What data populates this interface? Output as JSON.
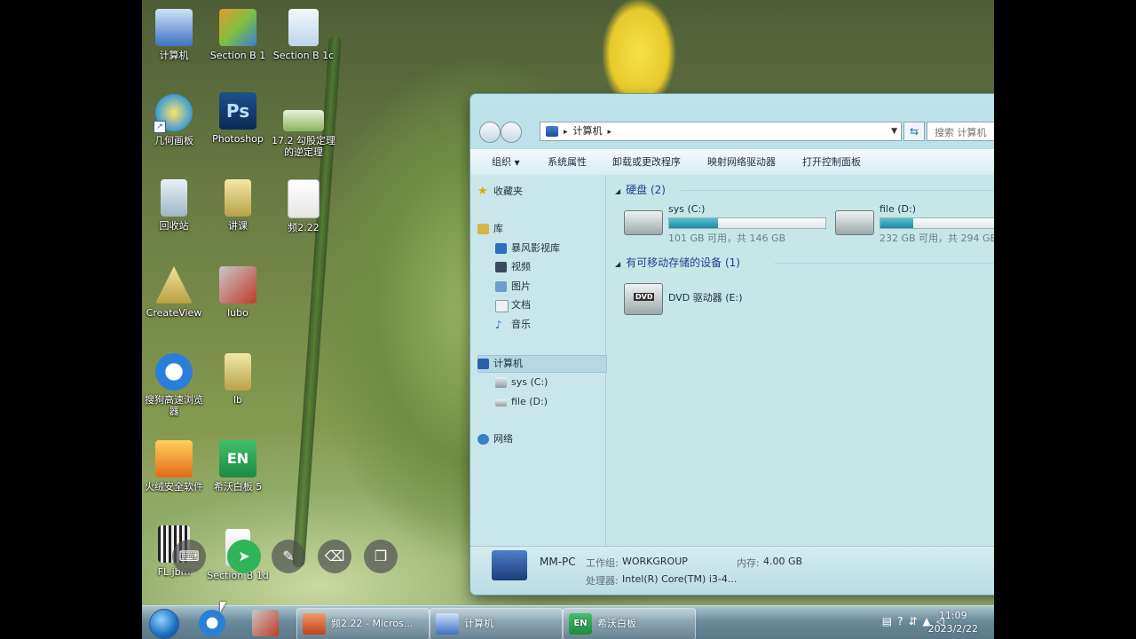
{
  "desktop": {
    "icons": [
      {
        "label": "计算机",
        "icon": "computer-icon"
      },
      {
        "label": "Section B 1",
        "icon": "ppt-icon"
      },
      {
        "label": "Section B 1c",
        "icon": "mp3-icon"
      },
      {
        "label": "几何画板",
        "icon": "geometry-app-icon"
      },
      {
        "label": "Photoshop",
        "icon": "photoshop-icon"
      },
      {
        "label": "17.2 勾股定理的逆定理",
        "icon": "ppt-icon"
      },
      {
        "label": "回收站",
        "icon": "recycle-bin-icon"
      },
      {
        "label": "讲课",
        "icon": "folder-icon"
      },
      {
        "label": "频2.22",
        "icon": "ppt-icon"
      },
      {
        "label": "CreateView",
        "icon": "createview-icon"
      },
      {
        "label": "lubo",
        "icon": "tools-icon"
      },
      {
        "label": "搜狗高速浏览器",
        "icon": "sogou-browser-icon"
      },
      {
        "label": "lb",
        "icon": "folder-icon"
      },
      {
        "label": "火绒安全软件",
        "icon": "huorong-icon"
      },
      {
        "label": "希沃白板 5",
        "icon": "seewo-icon"
      },
      {
        "label": "FL.jbm",
        "icon": "qr-file-icon"
      },
      {
        "label": "Section B 1d",
        "icon": "file-icon"
      }
    ]
  },
  "explorer": {
    "address": "计算机",
    "search_placeholder": "搜索 计算机",
    "toolbar": {
      "organize": "组织",
      "system_properties": "系统属性",
      "uninstall": "卸载或更改程序",
      "map_drive": "映射网络驱动器",
      "control_panel": "打开控制面板"
    },
    "nav": {
      "favorites": "收藏夹",
      "library": "库",
      "library_items": [
        "暴风影视库",
        "视频",
        "图片",
        "文档",
        "音乐"
      ],
      "computer": "计算机",
      "drives": [
        "sys (C:)",
        "file (D:)"
      ],
      "network": "网络"
    },
    "groups": {
      "hdd": "硬盘 (2)",
      "removable": "有可移动存储的设备 (1)"
    },
    "drives": [
      {
        "name": "sys (C:)",
        "size_text": "101 GB 可用，共 146 GB",
        "used_fraction": 0.31
      },
      {
        "name": "file (D:)",
        "size_text": "232 GB 可用，共 294 GB",
        "used_fraction": 0.21
      }
    ],
    "dvd": {
      "name": "DVD 驱动器 (E:)",
      "badge": "DVD"
    },
    "status": {
      "pc_name": "MM-PC",
      "workgroup_label": "工作组:",
      "workgroup": "WORKGROUP",
      "memory_label": "内存:",
      "memory": "4.00 GB",
      "cpu_label": "处理器:",
      "cpu": "Intel(R) Core(TM) i3-4..."
    }
  },
  "taskbar": {
    "buttons": [
      {
        "label": "频2.22 - Micros...",
        "icon": "powerpoint-icon"
      },
      {
        "label": "计算机",
        "icon": "computer-icon"
      },
      {
        "label": "希沃白板",
        "icon": "seewo-icon"
      }
    ],
    "seewo_badge": "EN",
    "time": "11:09",
    "date": "2023/2/22"
  },
  "colors": {
    "accent": "#1d8da0",
    "group_header": "#1f3f8f"
  }
}
